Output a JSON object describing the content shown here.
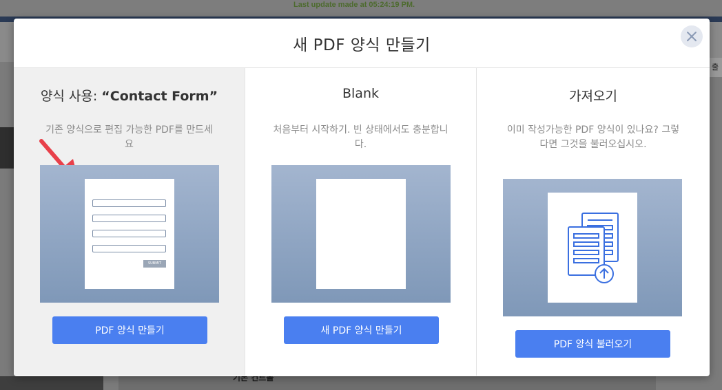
{
  "background": {
    "update_text": "Last update made at 05:24:19 PM.",
    "right_button_text": "출",
    "bottom_text": "기본 컨트롤"
  },
  "modal": {
    "title": "새 PDF 양식 만들기",
    "close_icon": "close-icon"
  },
  "options": [
    {
      "title_prefix": "양식 사용: ",
      "title_bold": "“Contact Form”",
      "description": "기존 양식으로 편집 가능한 PDF를 만드세요",
      "submit_label": "SUBMIT",
      "button_label": "PDF 양식 만들기"
    },
    {
      "title": "Blank",
      "description": "처음부터 시작하기. 빈 상태에서도 충분합니다.",
      "button_label": "새 PDF 양식 만들기"
    },
    {
      "title": "가져오기",
      "description": "이미 작성가능한 PDF 양식이 있나요? 그렇다면 그것을 불러오십시오.",
      "button_label": "PDF 양식 불러오기"
    }
  ],
  "colors": {
    "accent": "#4a7ff0",
    "arrow": "#e8404a",
    "preview_top": "#a3b5cf",
    "preview_bottom": "#7f98b8",
    "icon_blue": "#3a6fe0"
  }
}
